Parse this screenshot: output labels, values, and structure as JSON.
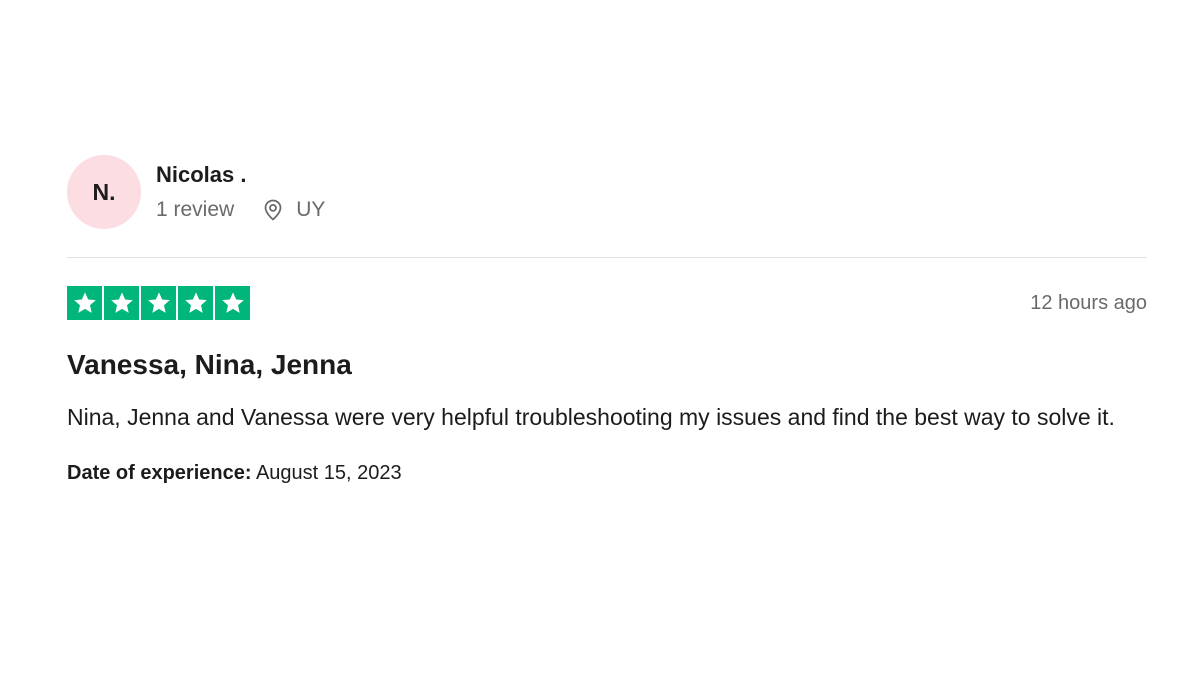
{
  "reviewer": {
    "initials": "N.",
    "name": "Nicolas .",
    "review_count": "1 review",
    "location": "UY",
    "location_icon": "map-pin-icon",
    "avatar_color": "#fbdde2"
  },
  "review": {
    "rating": 5,
    "max_rating": 5,
    "star_color": "#00b67a",
    "timestamp": "12 hours ago",
    "title": "Vanessa, Nina, Jenna",
    "body": "Nina, Jenna and Vanessa were very helpful troubleshooting my issues and find the best way to solve it.",
    "experience_label": "Date of experience:",
    "experience_date": "August 15, 2023"
  }
}
